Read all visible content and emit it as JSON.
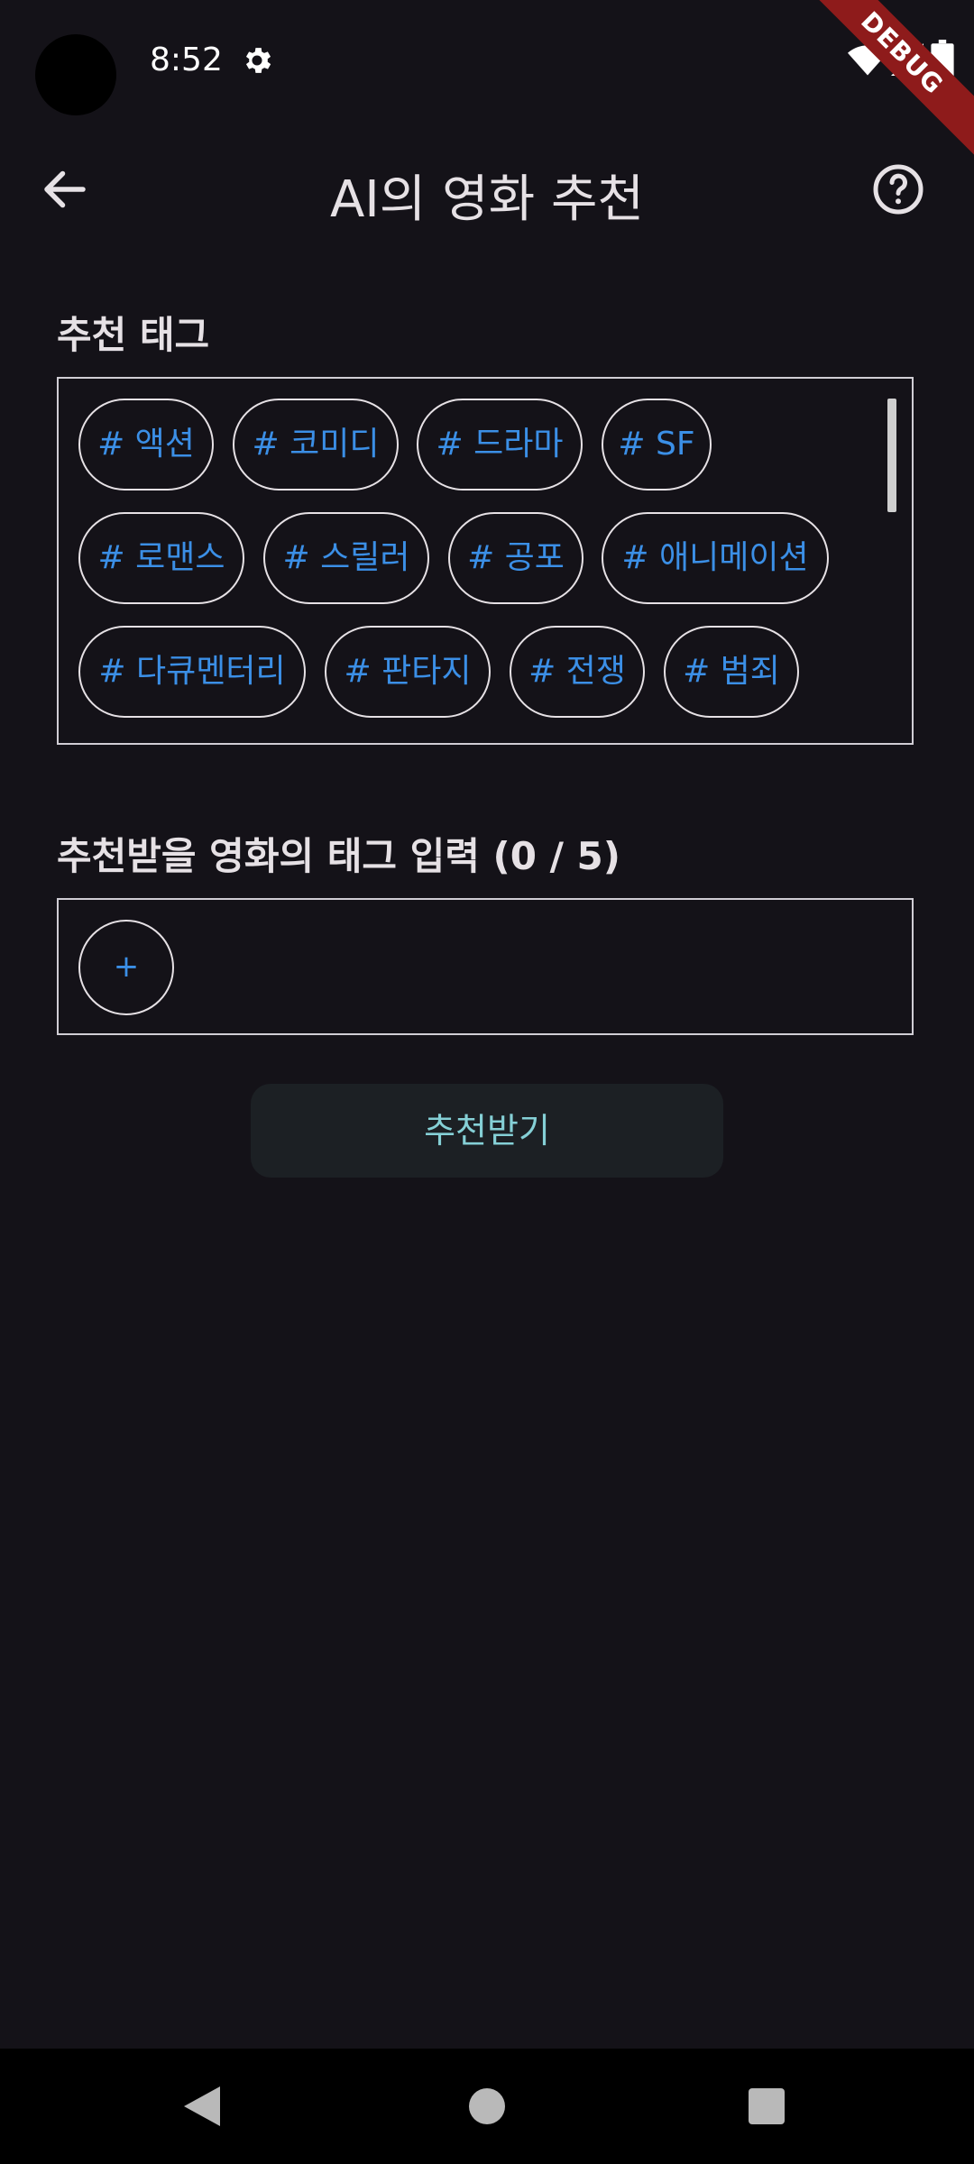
{
  "status_bar": {
    "time": "8:52",
    "debug_label": "DEBUG"
  },
  "app_bar": {
    "title": "AI의 영화 추천"
  },
  "recommend_tags": {
    "label": "추천 태그",
    "tags": [
      "# 액션",
      "# 코미디",
      "# 드라마",
      "# SF",
      "# 로맨스",
      "# 스릴러",
      "# 공포",
      "# 애니메이션",
      "# 다큐멘터리",
      "# 판타지",
      "# 전쟁",
      "# 범죄"
    ]
  },
  "input_section": {
    "label": "추천받을 영화의 태그 입력  (0 / 5)",
    "add_label": "+"
  },
  "submit_button": {
    "label": "추천받기"
  },
  "colors": {
    "background": "#141218",
    "chip_text": "#3b8fe6",
    "submit_text": "#85d0d6",
    "debug_banner": "#8e1b1b"
  }
}
